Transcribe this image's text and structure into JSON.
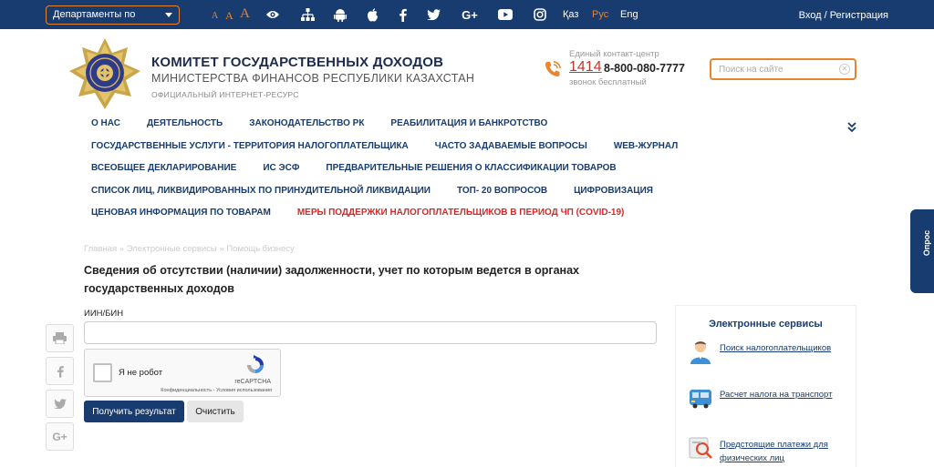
{
  "topbar": {
    "dept_select": "Департаменты по регионам",
    "font_sizes": [
      "A",
      "A",
      "A"
    ],
    "icons": [
      "eye-icon",
      "sitemap-icon",
      "android-icon",
      "apple-icon",
      "facebook-icon",
      "twitter-icon",
      "google-plus-icon",
      "youtube-icon",
      "instagram-icon"
    ],
    "langs": [
      "Қаз",
      "Рус",
      "Eng"
    ],
    "active_lang": "Рус",
    "login": "Вход / Регистрация"
  },
  "header": {
    "org_title": "КОМИТЕТ ГОСУДАРСТВЕННЫХ ДОХОДОВ",
    "ministry": "МИНИСТЕРСТВА ФИНАНСОВ РЕСПУБЛИКИ КАЗАХСТАН",
    "official": "ОФИЦИАЛЬНЫЙ ИНТЕРНЕТ-РЕСУРС",
    "contact_label": "Единый контакт-центр",
    "short_number": "1414",
    "long_number": "8-800-080-7777",
    "free_call": "звонок бесплатный",
    "search_placeholder": "Поиск на сайте"
  },
  "nav": {
    "row1": [
      "О НАС",
      "ДЕЯТЕЛЬНОСТЬ",
      "ЗАКОНОДАТЕЛЬСТВО РК",
      "РЕАБИЛИТАЦИЯ И БАНКРОТСТВО"
    ],
    "row2": [
      "ГОСУДАРСТВЕННЫЕ УСЛУГИ - ТЕРРИТОРИЯ НАЛОГОПЛАТЕЛЬЩИКА",
      "ЧАСТО ЗАДАВАЕМЫЕ ВОПРОСЫ",
      "WEB-ЖУРНАЛ"
    ],
    "row3": [
      "ВСЕОБЩЕЕ ДЕКЛАРИРОВАНИЕ",
      "ИС ЭСФ",
      "ПРЕДВАРИТЕЛЬНЫЕ РЕШЕНИЯ О КЛАССИФИКАЦИИ ТОВАРОВ"
    ],
    "row4": [
      "СПИСОК ЛИЦ, ЛИКВИДИРОВАННЫХ ПО ПРИНУДИТЕЛЬНОЙ ЛИКВИДАЦИИ",
      "ТОП- 20 ВОПРОСОВ",
      "ЦИФРОВИЗАЦИЯ"
    ],
    "row5": [
      "ЦЕНОВАЯ ИНФОРМАЦИЯ ПО ТОВАРАМ",
      "МЕРЫ ПОДДЕРЖКИ НАЛОГОПЛАТЕЛЬЩИКОВ В ПЕРИОД ЧП (COVID-19)"
    ],
    "highlight_color": "#d42a2a"
  },
  "breadcrumb": {
    "items": [
      "Главная",
      "Электронные сервисы",
      "Помощь бизнесу"
    ],
    "separator": "»"
  },
  "main": {
    "title": "Сведения об отсутствии (наличии) задолженности, учет по которым ведется в органах государственных доходов",
    "field_label": "ИИН/БИН",
    "field_value": "",
    "captcha_label": "Я не робот",
    "captcha_brand": "reCAPTCHA",
    "captcha_terms": "Конфиденциальность - Условия использования",
    "submit_button": "Получить результат",
    "clear_button": "Очистить"
  },
  "share": [
    "print-icon",
    "facebook-icon",
    "twitter-icon",
    "google-plus-icon"
  ],
  "services": {
    "title": "Электронные сервисы",
    "items": [
      {
        "label": "Поиск налогоплательщиков",
        "icon": "person-icon"
      },
      {
        "label": "Расчет налога на транспорт",
        "icon": "bus-icon"
      },
      {
        "label": "Предстоящие платежи для физических лиц",
        "icon": "payment-search-icon"
      }
    ]
  },
  "poll": {
    "label": "Опрос"
  },
  "colors": {
    "primary": "#183c70",
    "accent": "#e8832e",
    "alert": "#d42a2a"
  }
}
